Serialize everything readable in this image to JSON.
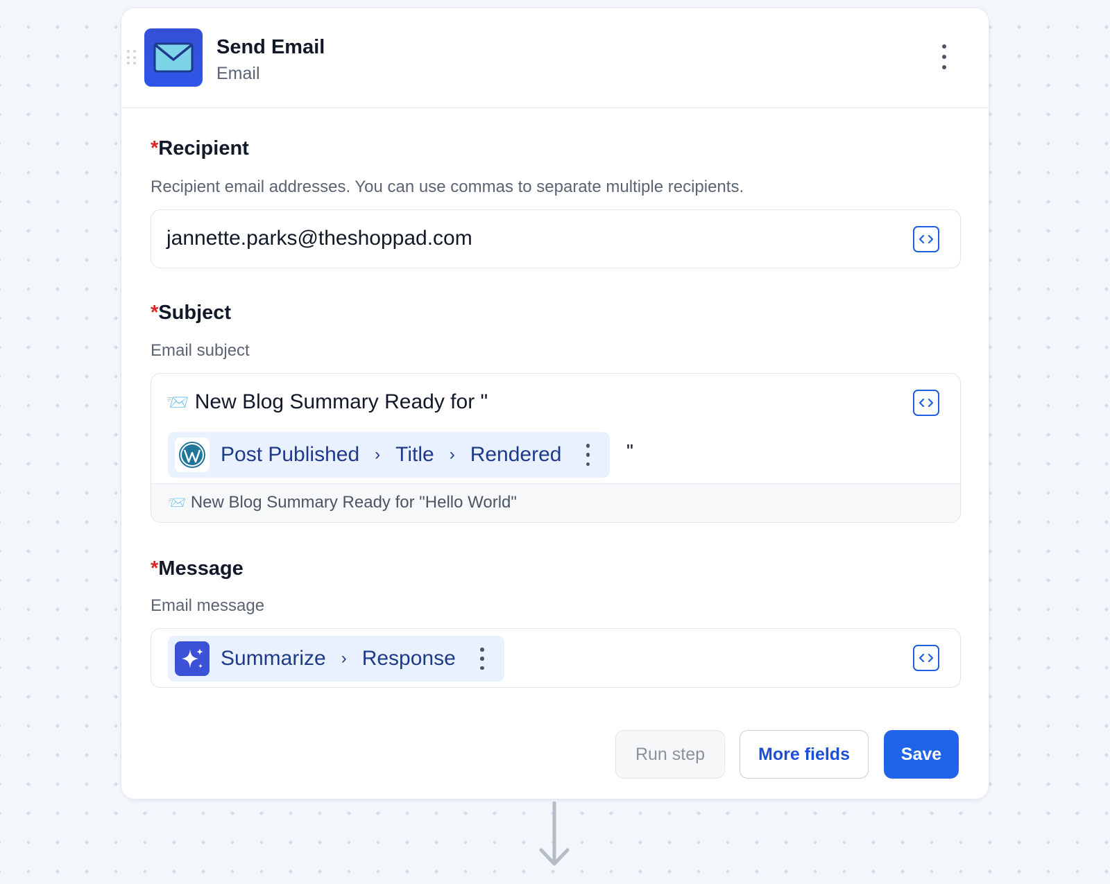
{
  "step": {
    "title": "Send Email",
    "app_name": "Email",
    "app_icon": "envelope-icon"
  },
  "recipient": {
    "required_mark": "*",
    "label": "Recipient",
    "help": "Recipient email addresses. You can use commas to separate multiple recipients.",
    "value": "jannette.parks@theshoppad.com"
  },
  "subject": {
    "required_mark": "*",
    "label": "Subject",
    "help": "Email subject",
    "prefix_emoji": "📨",
    "prefix_text": "New Blog Summary Ready for \"",
    "pill": {
      "icon": "wordpress-icon",
      "path": [
        "Post Published",
        "Title",
        "Rendered"
      ]
    },
    "suffix_text": "\"",
    "preview_emoji": "📨",
    "preview_text": "New Blog Summary Ready for \"Hello World\""
  },
  "message": {
    "required_mark": "*",
    "label": "Message",
    "help": "Email message",
    "pill": {
      "icon": "ai-sparkle-icon",
      "path": [
        "Summarize",
        "Response"
      ]
    }
  },
  "actions": {
    "run_step": "Run step",
    "more_fields": "More fields",
    "save": "Save"
  },
  "colors": {
    "accent": "#1f63e8",
    "pill_bg": "#e8f1fd",
    "pill_text": "#1e3a8a",
    "required": "#dc2626"
  }
}
